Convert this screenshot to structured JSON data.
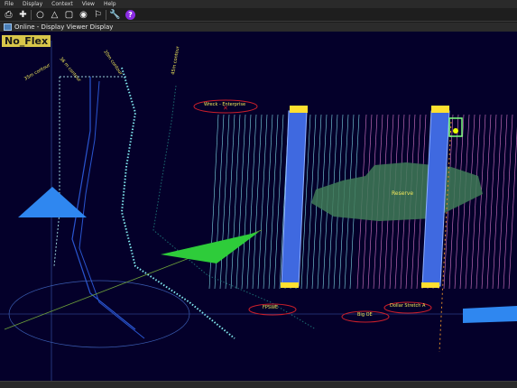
{
  "menu": {
    "items": [
      "File",
      "Display",
      "Context",
      "View",
      "Help"
    ]
  },
  "toolbar": {
    "icons": [
      "print-icon",
      "crosshair-icon",
      "circle-icon",
      "triangle-icon",
      "square-icon",
      "eye-icon",
      "flag-icon",
      "wrench-icon",
      "help-icon"
    ],
    "glyphs": {
      "print": "⎙",
      "crosshair": "✚",
      "circle": "○",
      "triangle": "△",
      "square": "▢",
      "eye": "◉",
      "flag": "⚐",
      "wrench": "🔧",
      "help": "?"
    }
  },
  "window": {
    "title": "Online - Display Viewer Display"
  },
  "mode_badge": "No_Flex",
  "contours": [
    "35m contour",
    "36 m contour",
    "20m contour",
    "45m contour"
  ],
  "targets": {
    "wreck": "Wreck - Enterprise",
    "fpsw": "FPSWE",
    "big_oe": "Big OE",
    "stretch": "Dollar Stretch A"
  },
  "area_label": "Reserve",
  "colors": {
    "background": "#04002a",
    "lines_cyan": "#7fd9e6",
    "lines_magenta": "#d879c9",
    "blue_bar": "#3f69e0",
    "green_area": "#3f7a57",
    "badge": "#d8c64a"
  }
}
